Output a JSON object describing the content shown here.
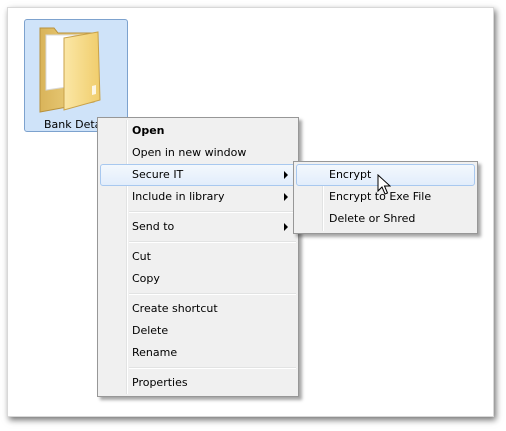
{
  "folder": {
    "label": "Bank Deta",
    "icon": "folder-icon"
  },
  "context_menu": {
    "items": [
      {
        "label": "Open",
        "bold": true
      },
      {
        "label": "Open in new window"
      },
      {
        "label": "Secure IT",
        "submenu": true,
        "highlighted": true
      },
      {
        "label": "Include in library",
        "submenu": true
      },
      {
        "label": "Send to",
        "submenu": true
      },
      {
        "label": "Cut"
      },
      {
        "label": "Copy"
      },
      {
        "label": "Create shortcut"
      },
      {
        "label": "Delete"
      },
      {
        "label": "Rename"
      },
      {
        "label": "Properties"
      }
    ]
  },
  "submenu": {
    "items": [
      {
        "label": "Encrypt",
        "highlighted": true
      },
      {
        "label": "Encrypt to Exe File"
      },
      {
        "label": "Delete or Shred"
      }
    ]
  },
  "colors": {
    "selection_fill": "#cfe3f9",
    "selection_border": "#7da2ce",
    "menu_background": "#f0f0f0",
    "highlight_border": "#a8c8ef"
  },
  "pointer": "mouse-pointer-icon"
}
